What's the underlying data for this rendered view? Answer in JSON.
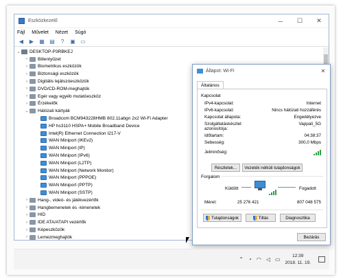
{
  "window": {
    "title": "Eszközkezelő",
    "menu": [
      "Fájl",
      "Művelet",
      "Nézet",
      "Súgó"
    ]
  },
  "tree": {
    "root": "DESKTOP-P3RBKEJ",
    "categories_top": [
      "Billentyűzet",
      "Biometrikus eszközök",
      "Biztonsági eszközök",
      "Digitális lejátszóeszközök",
      "DVD/CD-ROM-meghajtók",
      "Egér vagy egyéb mutatóeszköz",
      "Érzékelők",
      "Hálózati kártyák"
    ],
    "network_adapters": [
      "Broadcom BCM943228HMB 802.11abgn 2x2 Wi-Fi Adapter",
      "HP hs3110 HSPA+ Mobile Broadband Device",
      "Intel(R) Ethernet Connection I217-V",
      "WAN Miniport (IKEv2)",
      "WAN Miniport (IP)",
      "WAN Miniport (IPv6)",
      "WAN Miniport (L2TP)",
      "WAN Miniport (Network Monitor)",
      "WAN Miniport (PPPOE)",
      "WAN Miniport (PPTP)",
      "WAN Miniport (SSTP)"
    ],
    "categories_bottom": [
      "Hang-, videó- és játékvezérlők",
      "Hangbemenetek és -kimenetek",
      "HID",
      "IDE ATA/ATAPI vezérlők",
      "Képeszközök",
      "Lemezmeghajtók"
    ]
  },
  "wifi_dialog": {
    "title": "Állapot: Wi-Fi",
    "tab": "Általános",
    "connection_heading": "Kapcsolat",
    "rows": [
      {
        "label": "IPv4-kapcsolat:",
        "value": "Internet"
      },
      {
        "label": "IPv6-kapcsolat:",
        "value": "Nincs hálózati hozzáférés"
      },
      {
        "label": "Kapcsolat állapota:",
        "value": "Engedélyezve"
      },
      {
        "label": "Szolgáltatáskészlet azonosítója:",
        "value": "Vappali_5G"
      },
      {
        "label": "Időtartam:",
        "value": "04:38:37"
      },
      {
        "label": "Sebesség:",
        "value": "300,0 Mbps"
      }
    ],
    "signal_label": "Jelminőség:",
    "details_button": "Részletek...",
    "wireless_props_button": "Vezeték nélküli tulajdonságok",
    "activity_heading": "Forgalom",
    "sent_label": "Küldött",
    "received_label": "Fogadott",
    "bytes_label": "Méret:",
    "bytes_sent": "25 276 421",
    "bytes_received": "807 048 575",
    "properties_button": "Tulajdonságok",
    "disable_button": "Tiltás",
    "diagnose_button": "Diagnosztika",
    "close_button": "Bezárás"
  },
  "taskbar": {
    "time": "12:39",
    "date": "2018. 11. 19."
  }
}
